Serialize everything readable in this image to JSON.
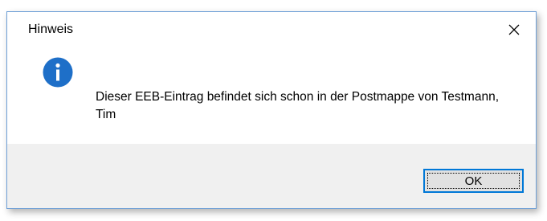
{
  "window": {
    "title": "Hinweis",
    "close_icon": "close-icon"
  },
  "message": {
    "icon": "info-icon",
    "text": "Dieser EEB-Eintrag befindet sich schon in der Postmappe von Testmann, Tim"
  },
  "buttons": {
    "ok_label": "OK"
  },
  "colors": {
    "info_icon": "#1e6fc8",
    "accent_border": "#0078d7",
    "footer_bg": "#f0f0f0",
    "dialog_border": "#6e9fd6"
  }
}
